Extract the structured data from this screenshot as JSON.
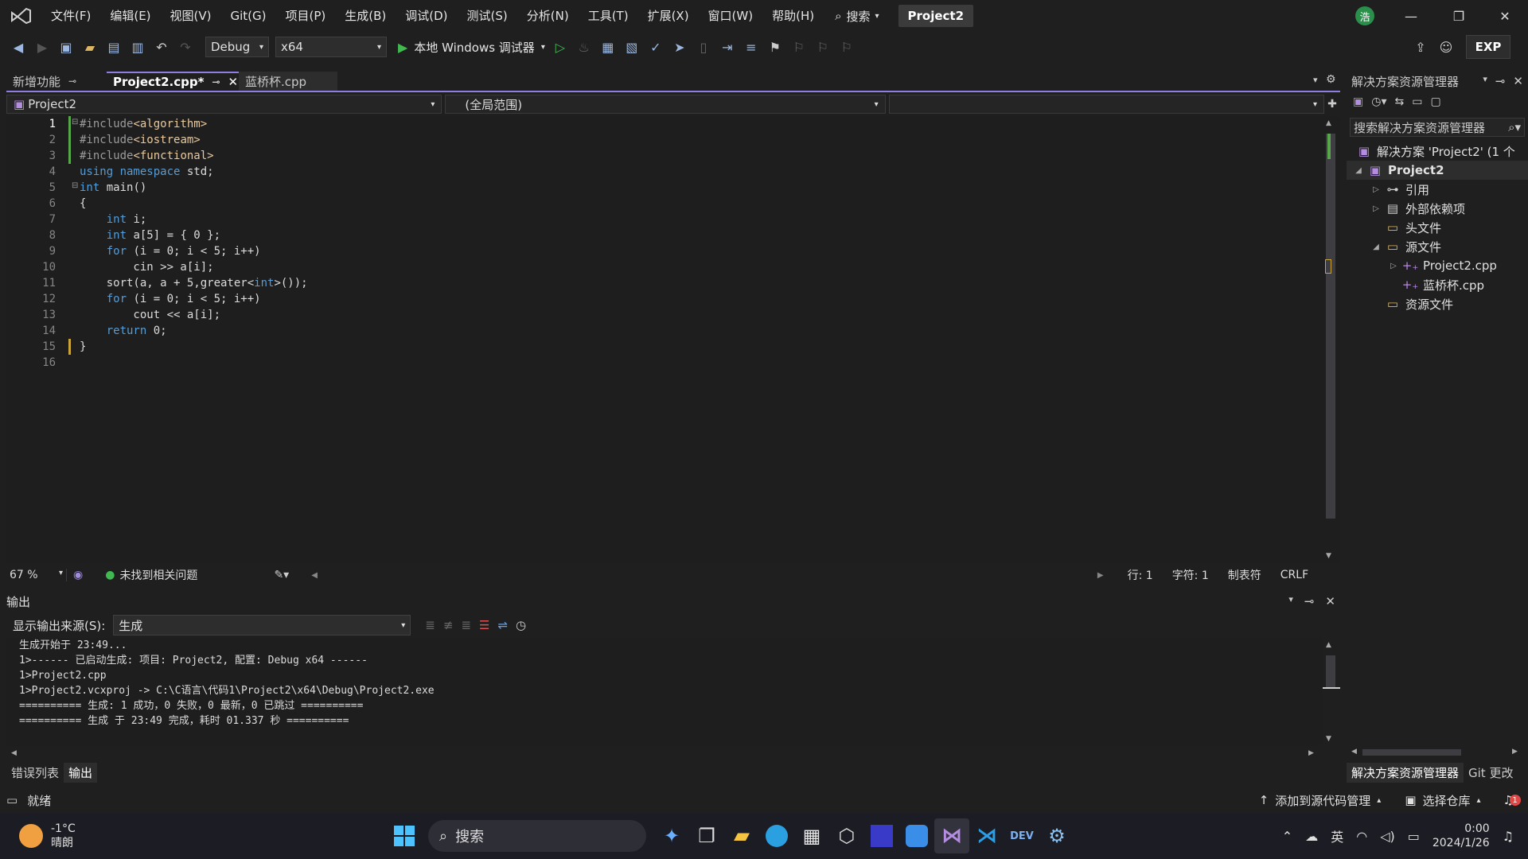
{
  "menu": {
    "items": [
      "文件(F)",
      "编辑(E)",
      "视图(V)",
      "Git(G)",
      "项目(P)",
      "生成(B)",
      "调试(D)",
      "测试(S)",
      "分析(N)",
      "工具(T)",
      "扩展(X)",
      "窗口(W)",
      "帮助(H)"
    ],
    "search_label": "搜索",
    "project_name": "Project2",
    "avatar_initial": "浩"
  },
  "toolbar": {
    "config": "Debug",
    "platform": "x64",
    "run_label": "本地 Windows 调试器",
    "exp_label": "EXP"
  },
  "tabs": {
    "features": "新增功能",
    "active": "Project2.cpp*",
    "other": "蓝桥杯.cpp"
  },
  "navbar": {
    "project": "Project2",
    "scope": "(全局范围)"
  },
  "editor": {
    "line_numbers": [
      "1",
      "2",
      "3",
      "4",
      "5",
      "6",
      "7",
      "8",
      "9",
      "10",
      "11",
      "12",
      "13",
      "14",
      "15",
      "16"
    ]
  },
  "status_line": {
    "zoom": "67 %",
    "issues": "未找到相关问题",
    "line": "行: 1",
    "char": "字符: 1",
    "tab_mode": "制表符",
    "eol": "CRLF"
  },
  "output": {
    "title": "输出",
    "source_label": "显示输出来源(S):",
    "source_value": "生成",
    "lines": [
      "生成开始于 23:49...",
      "1>------ 已启动生成: 项目: Project2, 配置: Debug x64 ------",
      "1>Project2.cpp",
      "1>Project2.vcxproj -> C:\\C语言\\代码1\\Project2\\x64\\Debug\\Project2.exe",
      "========== 生成: 1 成功，0 失败，0 最新，0 已跳过 ==========",
      "========== 生成 于 23:49 完成，耗时 01.337 秒 =========="
    ]
  },
  "bottom_tabs": {
    "errors": "错误列表",
    "output": "输出"
  },
  "solution_explorer": {
    "title": "解决方案资源管理器",
    "search_placeholder": "搜索解决方案资源管理器",
    "solution": "解决方案 'Project2' (1 个",
    "project": "Project2",
    "nodes": [
      "引用",
      "外部依赖项",
      "头文件",
      "源文件",
      "Project2.cpp",
      "蓝桥杯.cpp",
      "资源文件"
    ],
    "tab_se": "解决方案资源管理器",
    "tab_git": "Git 更改"
  },
  "statusbar": {
    "ready": "就绪",
    "add_source": "添加到源代码管理",
    "select_repo": "选择仓库",
    "notif_count": "1"
  },
  "taskbar": {
    "weather_temp": "-1°C",
    "weather_desc": "晴朗",
    "search": "搜索",
    "ime": "英",
    "time": "0:00",
    "date": "2024/1/26"
  }
}
